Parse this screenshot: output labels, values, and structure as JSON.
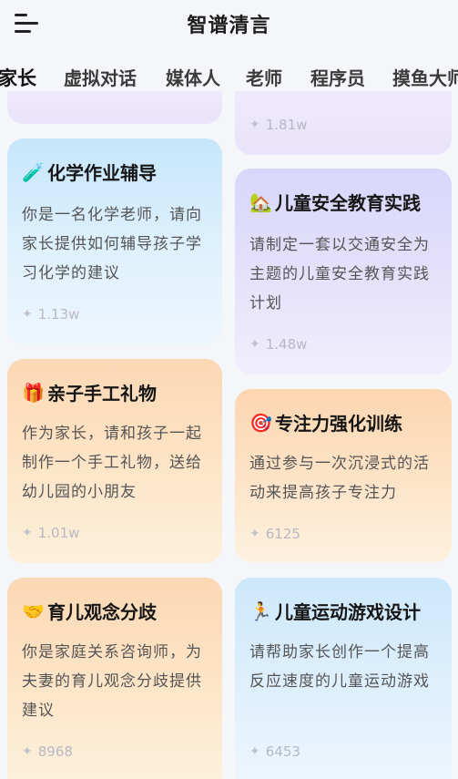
{
  "header": {
    "title": "智谱清言",
    "menu_icon": "hamburger-menu-icon"
  },
  "tabs": [
    {
      "label": "家长",
      "active": true
    },
    {
      "label": "虚拟对话",
      "active": false
    },
    {
      "label": "媒体人",
      "active": false
    },
    {
      "label": "老师",
      "active": false
    },
    {
      "label": "程序员",
      "active": false
    },
    {
      "label": "摸鱼大师",
      "active": false
    }
  ],
  "accent_color": "#2e5bff",
  "cards": {
    "top_right_partial": {
      "stat": "1.81w"
    },
    "chem": {
      "emoji": "🧪",
      "title": "化学作业辅导",
      "desc": "你是一名化学老师，请向家长提供如何辅导孩子学习化学的建议",
      "stat": "1.13w"
    },
    "safety": {
      "emoji": "🏡",
      "title": "儿童安全教育实践",
      "desc": "请制定一套以交通安全为主题的儿童安全教育实践计划",
      "stat": "1.48w"
    },
    "gift": {
      "emoji": "🎁",
      "title": "亲子手工礼物",
      "desc": "作为家长，请和孩子一起制作一个手工礼物，送给幼儿园的小朋友",
      "stat": "1.01w"
    },
    "focus": {
      "emoji": "🎯",
      "title": "专注力强化训练",
      "desc": "通过参与一次沉浸式的活动来提高孩子专注力",
      "stat": "6125"
    },
    "parenting": {
      "emoji": "🤝",
      "title": "育儿观念分歧",
      "desc": "你是家庭关系咨询师，为夫妻的育儿观念分歧提供建议",
      "stat": "8968"
    },
    "sports": {
      "emoji": "🏃",
      "title": "儿童运动游戏设计",
      "desc": "请帮助家长创作一个提高反应速度的儿童运动游戏",
      "stat": "6453"
    }
  },
  "star_glyph": "✦"
}
